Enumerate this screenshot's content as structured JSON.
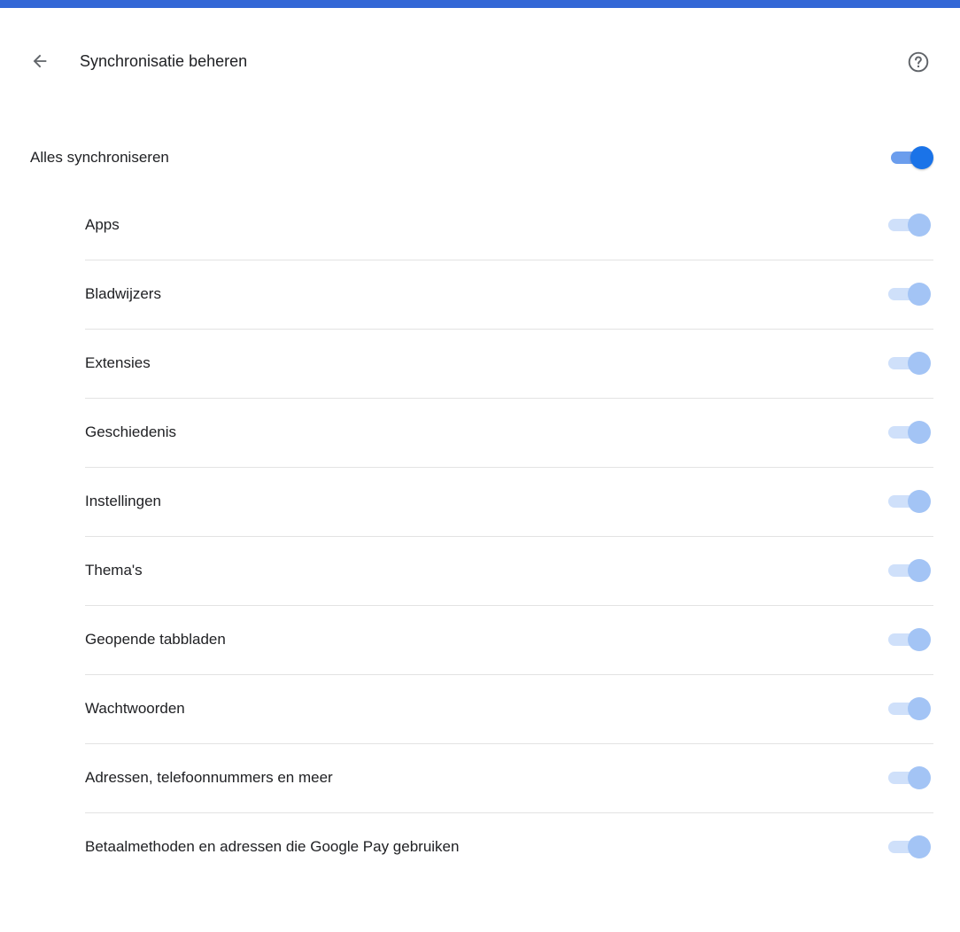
{
  "header": {
    "title": "Synchronisatie beheren",
    "back_icon": "arrow-left-icon",
    "help_icon": "help-circle-icon"
  },
  "colors": {
    "top_bar": "#3367d6",
    "toggle_on_knob": "#1a73e8",
    "toggle_on_track": "#6b9ded",
    "toggle_disabled_knob": "#a3c4f5",
    "toggle_disabled_track": "#cfe0fa"
  },
  "sync_all": {
    "label": "Alles synchroniseren",
    "enabled": true
  },
  "items": [
    {
      "label": "Apps",
      "checked": true,
      "disabled": true
    },
    {
      "label": "Bladwijzers",
      "checked": true,
      "disabled": true
    },
    {
      "label": "Extensies",
      "checked": true,
      "disabled": true
    },
    {
      "label": "Geschiedenis",
      "checked": true,
      "disabled": true
    },
    {
      "label": "Instellingen",
      "checked": true,
      "disabled": true
    },
    {
      "label": "Thema's",
      "checked": true,
      "disabled": true
    },
    {
      "label": "Geopende tabbladen",
      "checked": true,
      "disabled": true
    },
    {
      "label": "Wachtwoorden",
      "checked": true,
      "disabled": true
    },
    {
      "label": "Adressen, telefoonnummers en meer",
      "checked": true,
      "disabled": true
    },
    {
      "label": "Betaalmethoden en adressen die Google Pay gebruiken",
      "checked": true,
      "disabled": true
    }
  ]
}
